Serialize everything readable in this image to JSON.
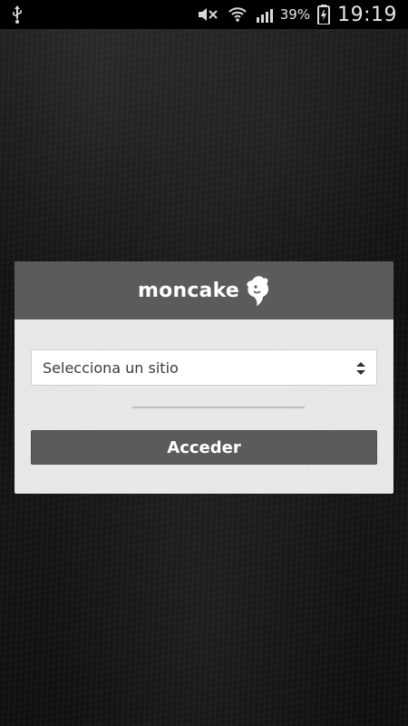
{
  "status_bar": {
    "battery_percent": "39%",
    "time": "19:19",
    "icons": [
      "usb-icon",
      "silent-mode-icon",
      "wifi-icon",
      "signal-icon",
      "battery-icon"
    ]
  },
  "login_card": {
    "brand": "moncake",
    "site_select": {
      "value": "Selecciona un sitio"
    },
    "submit_label": "Acceder"
  },
  "colors": {
    "card_header": "#5b5b5b",
    "button": "#5b5b5b",
    "card_body": "#f0f0f0",
    "status_bar": "#000000"
  }
}
